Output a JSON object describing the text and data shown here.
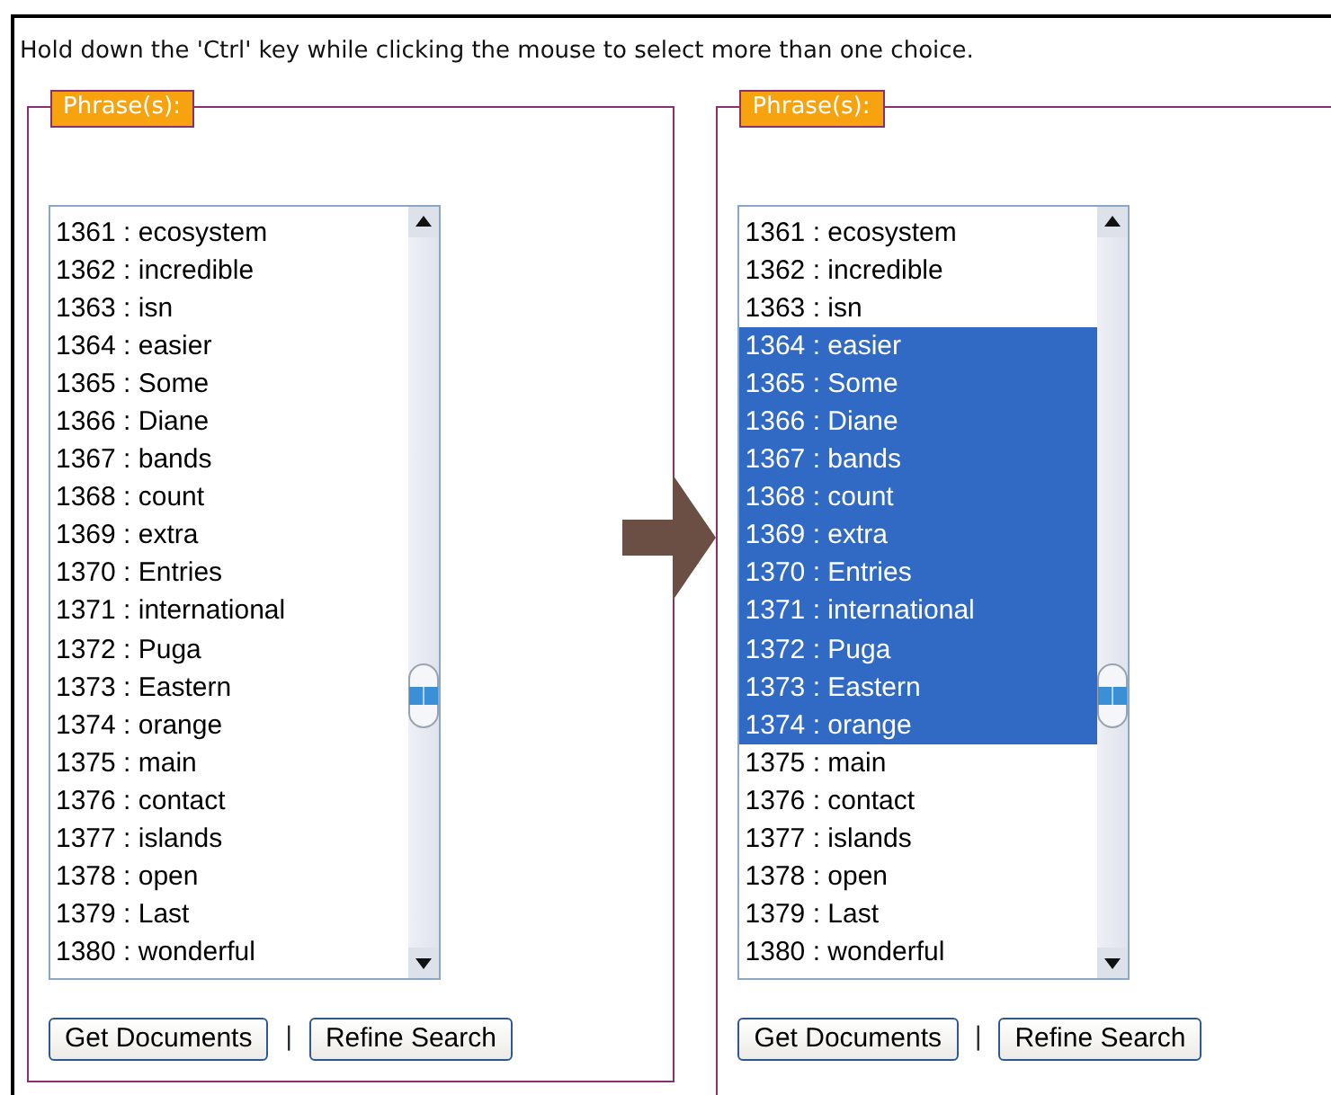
{
  "instruction": "Hold down the 'Ctrl' key while clicking the mouse to select more than one choice.",
  "panels": [
    {
      "legend": "Phrase(s):",
      "options": [
        {
          "label": "1361 : ecosystem",
          "selected": false
        },
        {
          "label": "1362 : incredible",
          "selected": false
        },
        {
          "label": "1363 : isn",
          "selected": false
        },
        {
          "label": "1364 : easier",
          "selected": false
        },
        {
          "label": "1365 : Some",
          "selected": false
        },
        {
          "label": "1366 : Diane",
          "selected": false
        },
        {
          "label": "1367 : bands",
          "selected": false
        },
        {
          "label": "1368 : count",
          "selected": false
        },
        {
          "label": "1369 : extra",
          "selected": false
        },
        {
          "label": "1370 : Entries",
          "selected": false
        },
        {
          "label": "1371 : international",
          "selected": false
        },
        {
          "label": "1372 : Puga",
          "selected": false
        },
        {
          "label": "1373 : Eastern",
          "selected": false
        },
        {
          "label": "1374 : orange",
          "selected": false
        },
        {
          "label": "1375 : main",
          "selected": false
        },
        {
          "label": "1376 : contact",
          "selected": false
        },
        {
          "label": "1377 : islands",
          "selected": false
        },
        {
          "label": "1378 : open",
          "selected": false
        },
        {
          "label": "1379 : Last",
          "selected": false
        },
        {
          "label": "1380 : wonderful",
          "selected": false
        }
      ],
      "buttons": [
        "Get Documents",
        "Refine Search"
      ],
      "separator": "|"
    },
    {
      "legend": "Phrase(s):",
      "options": [
        {
          "label": "1361 : ecosystem",
          "selected": false
        },
        {
          "label": "1362 : incredible",
          "selected": false
        },
        {
          "label": "1363 : isn",
          "selected": false
        },
        {
          "label": "1364 : easier",
          "selected": true
        },
        {
          "label": "1365 : Some",
          "selected": true
        },
        {
          "label": "1366 : Diane",
          "selected": true
        },
        {
          "label": "1367 : bands",
          "selected": true
        },
        {
          "label": "1368 : count",
          "selected": true
        },
        {
          "label": "1369 : extra",
          "selected": true
        },
        {
          "label": "1370 : Entries",
          "selected": true
        },
        {
          "label": "1371 : international",
          "selected": true
        },
        {
          "label": "1372 : Puga",
          "selected": true
        },
        {
          "label": "1373 : Eastern",
          "selected": true
        },
        {
          "label": "1374 : orange",
          "selected": true
        },
        {
          "label": "1375 : main",
          "selected": false
        },
        {
          "label": "1376 : contact",
          "selected": false
        },
        {
          "label": "1377 : islands",
          "selected": false
        },
        {
          "label": "1378 : open",
          "selected": false
        },
        {
          "label": "1379 : Last",
          "selected": false
        },
        {
          "label": "1380 : wonderful",
          "selected": false
        }
      ],
      "buttons": [
        "Get Documents",
        "Refine Search"
      ],
      "separator": "|"
    }
  ]
}
